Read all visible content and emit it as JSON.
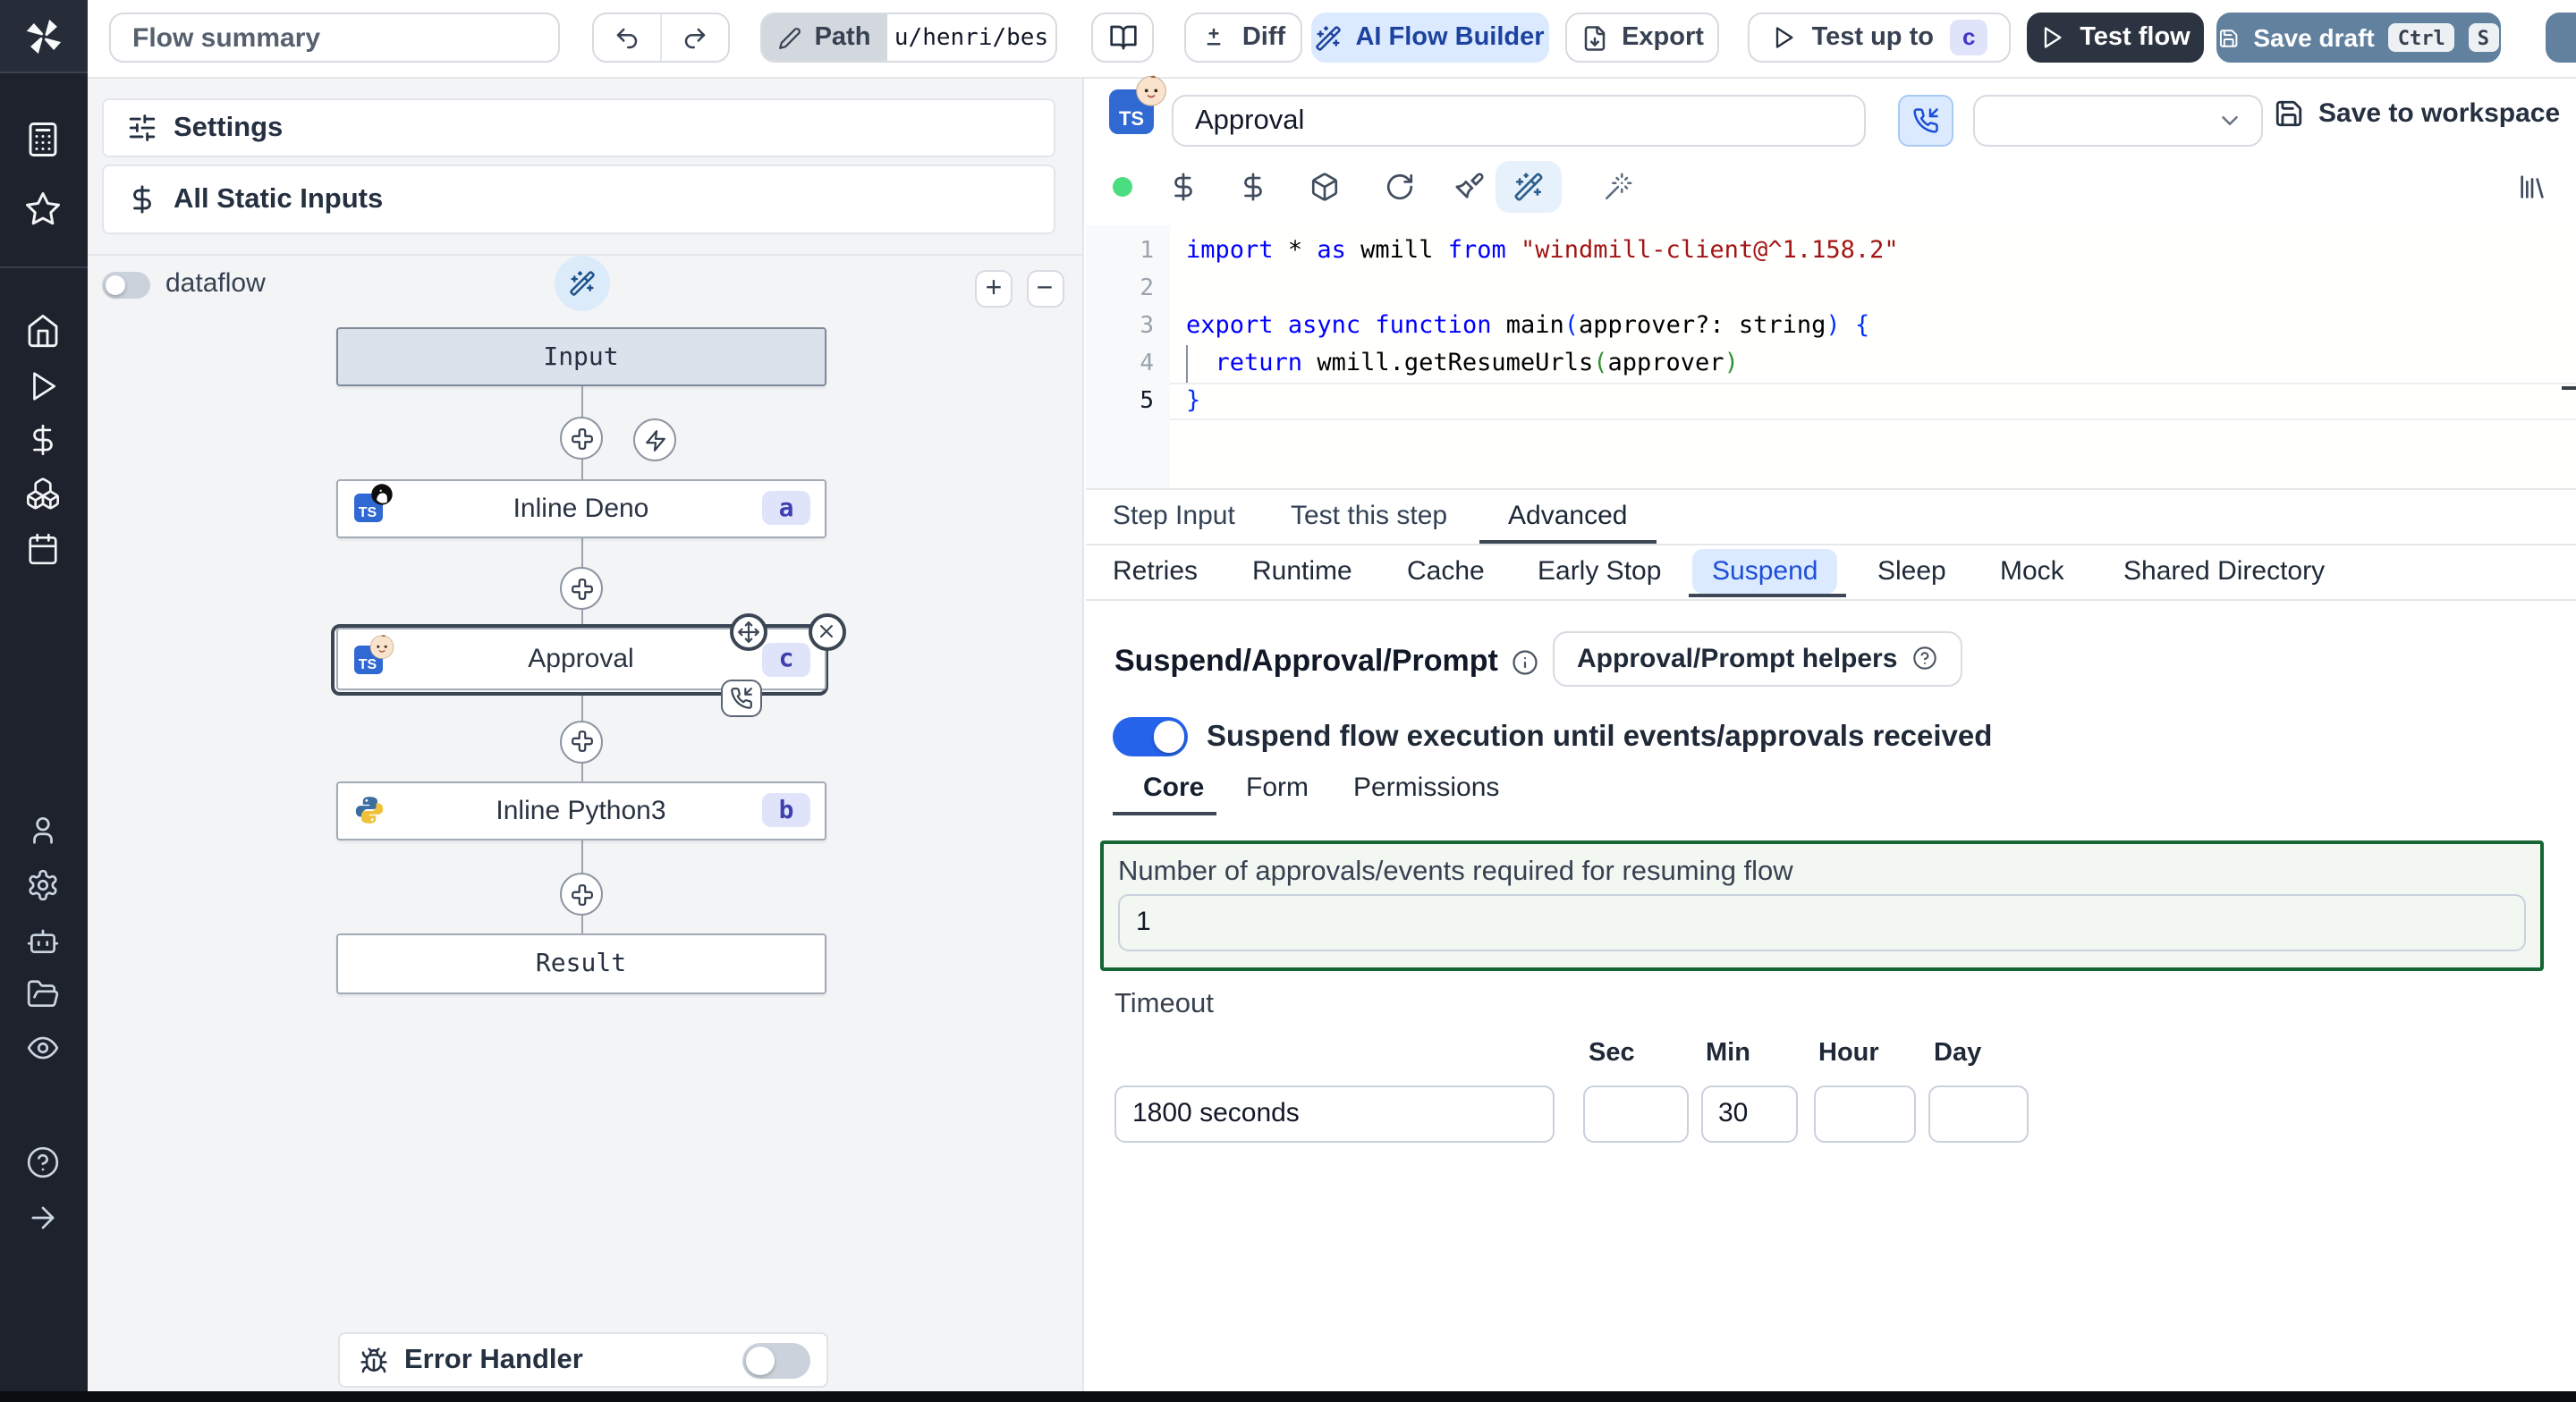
{
  "colors": {
    "accent_blue": "#2563eb",
    "sidebar_bg": "#1d222d",
    "panel_bg": "#f3f4f6",
    "save_draft_bg": "#61819f",
    "test_flow_bg": "#2b3440",
    "ai_builder_bg": "#dbeafe",
    "selected_ring": "#3b4554",
    "suspend_green_border": "#166534",
    "badge_bg": "#dfe4fb",
    "badge_text": "#3f3fae"
  },
  "topbar": {
    "flow_summary_placeholder": "Flow summary",
    "path_label": "Path",
    "path_value": "u/henri/bes",
    "diff_label": "Diff",
    "ai_flow_builder_label": "AI Flow Builder",
    "export_label": "Export",
    "test_up_to_label": "Test up to",
    "test_up_to_badge": "c",
    "test_flow_label": "Test flow",
    "save_draft_label": "Save draft",
    "shortcut_ctrl": "Ctrl",
    "shortcut_s": "S"
  },
  "left_panel": {
    "settings_label": "Settings",
    "all_static_inputs_label": "All Static Inputs",
    "dataflow_label": "dataflow",
    "zoom_in_label": "+",
    "zoom_out_label": "−",
    "error_handler_label": "Error Handler"
  },
  "graph": {
    "input_node_label": "Input",
    "result_node_label": "Result",
    "steps": [
      {
        "label": "Inline Deno",
        "badge": "a",
        "language": "deno-typescript"
      },
      {
        "label": "Approval",
        "badge": "c",
        "language": "bun-typescript",
        "selected": true
      },
      {
        "label": "Inline Python3",
        "badge": "b",
        "language": "python3"
      }
    ]
  },
  "step_editor": {
    "name_value": "Approval",
    "language": "bun-typescript",
    "save_to_workspace_label": "Save to workspace",
    "status_dot_color": "#4ade80",
    "code": {
      "lines": [
        {
          "no": "1",
          "tokens": [
            {
              "c": "tk-kw",
              "t": "import"
            },
            {
              "c": "tk-pl",
              "t": " * "
            },
            {
              "c": "tk-kw",
              "t": "as"
            },
            {
              "c": "tk-pl",
              "t": " wmill "
            },
            {
              "c": "tk-kw",
              "t": "from"
            },
            {
              "c": "tk-pl",
              "t": " "
            },
            {
              "c": "tk-str",
              "t": "\"windmill-client@^1.158.2\""
            }
          ]
        },
        {
          "no": "2",
          "tokens": []
        },
        {
          "no": "3",
          "tokens": [
            {
              "c": "tk-kw",
              "t": "export"
            },
            {
              "c": "tk-pl",
              "t": " "
            },
            {
              "c": "tk-kw",
              "t": "async"
            },
            {
              "c": "tk-pl",
              "t": " "
            },
            {
              "c": "tk-kw",
              "t": "function"
            },
            {
              "c": "tk-pl",
              "t": " main"
            },
            {
              "c": "tk-b1",
              "t": "("
            },
            {
              "c": "tk-pl",
              "t": "approver?: string"
            },
            {
              "c": "tk-b1",
              "t": ")"
            },
            {
              "c": "tk-pl",
              "t": " "
            },
            {
              "c": "tk-b1",
              "t": "{"
            }
          ]
        },
        {
          "no": "4",
          "tokens": [
            {
              "c": "tk-pl",
              "t": "  "
            },
            {
              "c": "tk-kw",
              "t": "return"
            },
            {
              "c": "tk-pl",
              "t": " wmill.getResumeUrls"
            },
            {
              "c": "tk-b2",
              "t": "("
            },
            {
              "c": "tk-pl",
              "t": "approver"
            },
            {
              "c": "tk-b2",
              "t": ")"
            }
          ],
          "indent_guide": true
        },
        {
          "no": "5",
          "tokens": [
            {
              "c": "tk-b1",
              "t": "}"
            }
          ],
          "active": true
        }
      ]
    },
    "tabs": {
      "items": [
        "Step Input",
        "Test this step",
        "Advanced"
      ],
      "active": "Advanced"
    },
    "advanced_tabs": {
      "items": [
        "Retries",
        "Runtime",
        "Cache",
        "Early Stop",
        "Suspend",
        "Sleep",
        "Mock",
        "Shared Directory"
      ],
      "active": "Suspend"
    },
    "suspend_section": {
      "heading": "Suspend/Approval/Prompt",
      "helpers_button_label": "Approval/Prompt helpers",
      "toggle_label": "Suspend flow execution until events/approvals received",
      "toggle_on": true,
      "sub_tabs": {
        "items": [
          "Core",
          "Form",
          "Permissions"
        ],
        "active": "Core"
      },
      "approvals_label": "Number of approvals/events required for resuming flow",
      "approvals_value": "1",
      "timeout_label": "Timeout",
      "timeout_value": "1800 seconds",
      "units": [
        {
          "label": "Sec",
          "value": ""
        },
        {
          "label": "Min",
          "value": "30"
        },
        {
          "label": "Hour",
          "value": ""
        },
        {
          "label": "Day",
          "value": ""
        }
      ]
    }
  }
}
